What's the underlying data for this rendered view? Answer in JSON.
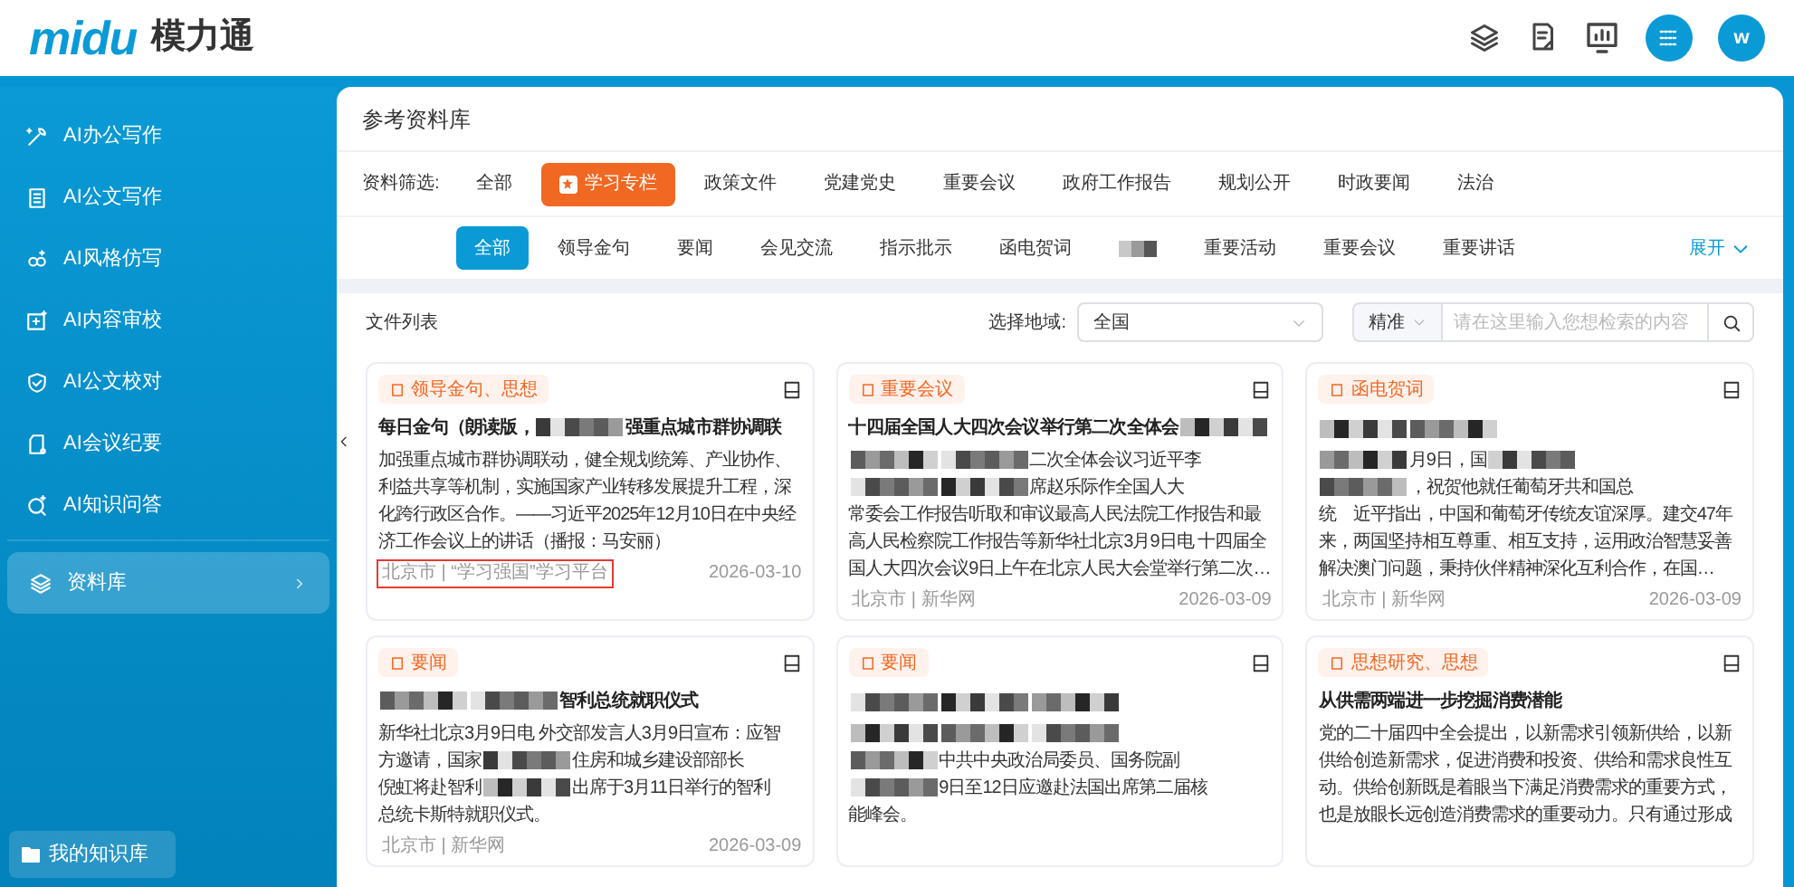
{
  "header": {
    "logo": "midu",
    "product": "模力通",
    "avatar": "w"
  },
  "sidebar": {
    "items": [
      {
        "label": "AI办公写作",
        "selected": false
      },
      {
        "label": "AI公文写作",
        "selected": false
      },
      {
        "label": "AI风格仿写",
        "selected": false
      },
      {
        "label": "AI内容审校",
        "selected": false
      },
      {
        "label": "AI公文校对",
        "selected": false
      },
      {
        "label": "AI会议纪要",
        "selected": false
      },
      {
        "label": "AI知识问答",
        "selected": false
      },
      {
        "label": "资料库",
        "selected": true
      }
    ],
    "bottom_button": "我的知识库"
  },
  "page_title": "参考资料库",
  "filter": {
    "label": "资料筛选:",
    "items": [
      {
        "label": "全部",
        "selected": false
      },
      {
        "label": "学习专栏",
        "selected": true
      },
      {
        "label": "政策文件",
        "selected": false
      },
      {
        "label": "党建党史",
        "selected": false
      },
      {
        "label": "重要会议",
        "selected": false
      },
      {
        "label": "政府工作报告",
        "selected": false
      },
      {
        "label": "规划公开",
        "selected": false
      },
      {
        "label": "时政要闻",
        "selected": false
      },
      {
        "label": "法治",
        "selected": false
      }
    ]
  },
  "subfilter": {
    "items": [
      {
        "kind": "text",
        "label": "全部",
        "selected": true
      },
      {
        "kind": "text",
        "label": "领导金句",
        "selected": false
      },
      {
        "kind": "text",
        "label": "要闻",
        "selected": false
      },
      {
        "kind": "text",
        "label": "会见交流",
        "selected": false
      },
      {
        "kind": "text",
        "label": "指示批示",
        "selected": false
      },
      {
        "kind": "text",
        "label": "函电贺词",
        "selected": false
      },
      {
        "kind": "redacted",
        "selected": false
      },
      {
        "kind": "text",
        "label": "重要活动",
        "selected": false
      },
      {
        "kind": "text",
        "label": "重要会议",
        "selected": false
      },
      {
        "kind": "text",
        "label": "重要讲话",
        "selected": false
      }
    ],
    "expand": "展开"
  },
  "list": {
    "title": "文件列表",
    "region_label": "选择地域:",
    "region": "全国",
    "mode": "精准",
    "search_placeholder": "请在这里输入您想检索的内容"
  },
  "cards": [
    {
      "tag": "领导金句、思想",
      "title": [
        {
          "kind": "text",
          "text": "每日金句（朗读版，"
        },
        {
          "kind": "redacted"
        },
        {
          "kind": "text",
          "text": "强重点城市群协调联"
        }
      ],
      "body": [
        [
          {
            "kind": "text",
            "text": "加强重点城市群协调联动，健全规划统筹、产业协作、利益共享等机制，实施国家产业转移发展提升工程，深化跨行政区合作。——习近平2025年12月10日在中央经济工作会议上的讲话（播报：马安丽）"
          }
        ]
      ],
      "source": "北京市 | “学习强国”学习平台",
      "highlighted": true,
      "date": "2026-03-10"
    },
    {
      "tag": "重要会议",
      "title": [
        {
          "kind": "text",
          "text": "十四届全国人大四次会议举行第二次全体会"
        },
        {
          "kind": "redacted"
        }
      ],
      "body": [
        [
          {
            "kind": "redacted"
          },
          {
            "kind": "redacted"
          },
          {
            "kind": "text",
            "text": "二次全体会议习近平李"
          }
        ],
        [
          {
            "kind": "redacted"
          },
          {
            "kind": "redacted"
          },
          {
            "kind": "text",
            "text": "席赵乐际作全国人大"
          }
        ],
        [
          {
            "kind": "text",
            "text": "常委会工作报告听取和审议最高人民法院工作报告和最高人民检察院工作报告等新华社北京3月9日电 十四届全国人大四次会议9日上午在北京人民大会堂举行第二次…"
          }
        ]
      ],
      "source": "北京市 | 新华网",
      "highlighted": false,
      "date": "2026-03-09"
    },
    {
      "tag": "函电贺词",
      "title": [
        {
          "kind": "redacted"
        },
        {
          "kind": "redacted"
        }
      ],
      "body": [
        [
          {
            "kind": "redacted"
          },
          {
            "kind": "text",
            "text": "月9日，国"
          },
          {
            "kind": "redacted"
          }
        ],
        [
          {
            "kind": "redacted"
          },
          {
            "kind": "text",
            "text": "，祝贺他就任葡萄牙共和国总"
          }
        ],
        [
          {
            "kind": "text",
            "text": "统　近平指出，中国和葡萄牙传统友谊深厚。建交47年来，两国坚持相互尊重、相互支持，运用政治智慧妥善解决澳门问题，秉持伙伴精神深化互利合作，在国…"
          }
        ]
      ],
      "source": "北京市 | 新华网",
      "highlighted": false,
      "date": "2026-03-09"
    },
    {
      "tag": "要闻",
      "title": [
        {
          "kind": "redacted"
        },
        {
          "kind": "redacted"
        },
        {
          "kind": "text",
          "text": "智利总统就职仪式"
        }
      ],
      "body": [
        [
          {
            "kind": "text",
            "text": "新华社北京3月9日电 外交部发言人3月9日宣布：应智"
          }
        ],
        [
          {
            "kind": "text",
            "text": "方邀请，国家"
          },
          {
            "kind": "redacted"
          },
          {
            "kind": "text",
            "text": "住房和城乡建设部部长"
          }
        ],
        [
          {
            "kind": "text",
            "text": "倪虹将赴智利"
          },
          {
            "kind": "redacted"
          },
          {
            "kind": "text",
            "text": "出席于3月11日举行的智利"
          }
        ],
        [
          {
            "kind": "text",
            "text": "总统卡斯特就职仪式。"
          }
        ]
      ],
      "source": "北京市 | 新华网",
      "highlighted": false,
      "date": "2026-03-09"
    },
    {
      "tag": "要闻",
      "title": [
        {
          "kind": "redacted"
        },
        {
          "kind": "redacted"
        },
        {
          "kind": "redacted"
        }
      ],
      "body": [
        [
          {
            "kind": "redacted"
          },
          {
            "kind": "redacted"
          },
          {
            "kind": "redacted"
          }
        ],
        [
          {
            "kind": "redacted"
          },
          {
            "kind": "text",
            "text": "中共中央政治局委员、国务院副"
          }
        ],
        [
          {
            "kind": "redacted"
          },
          {
            "kind": "text",
            "text": "9日至12日应邀赴法国出席第二届核"
          }
        ],
        [
          {
            "kind": "text",
            "text": "能峰会。"
          }
        ]
      ]
    },
    {
      "tag": "思想研究、思想",
      "title": [
        {
          "kind": "text",
          "text": "从供需两端进一步挖掘消费潜能"
        }
      ],
      "body": [
        [
          {
            "kind": "text",
            "text": "党的二十届四中全会提出，以新需求引领新供给，以新供给创造新需求，促进消费和投资、供给和需求良性互动。供给创新既是着眼当下满足消费需求的重要方式，也是放眼长远创造消费需求的重要动力。只有通过形成"
          }
        ]
      ]
    }
  ]
}
